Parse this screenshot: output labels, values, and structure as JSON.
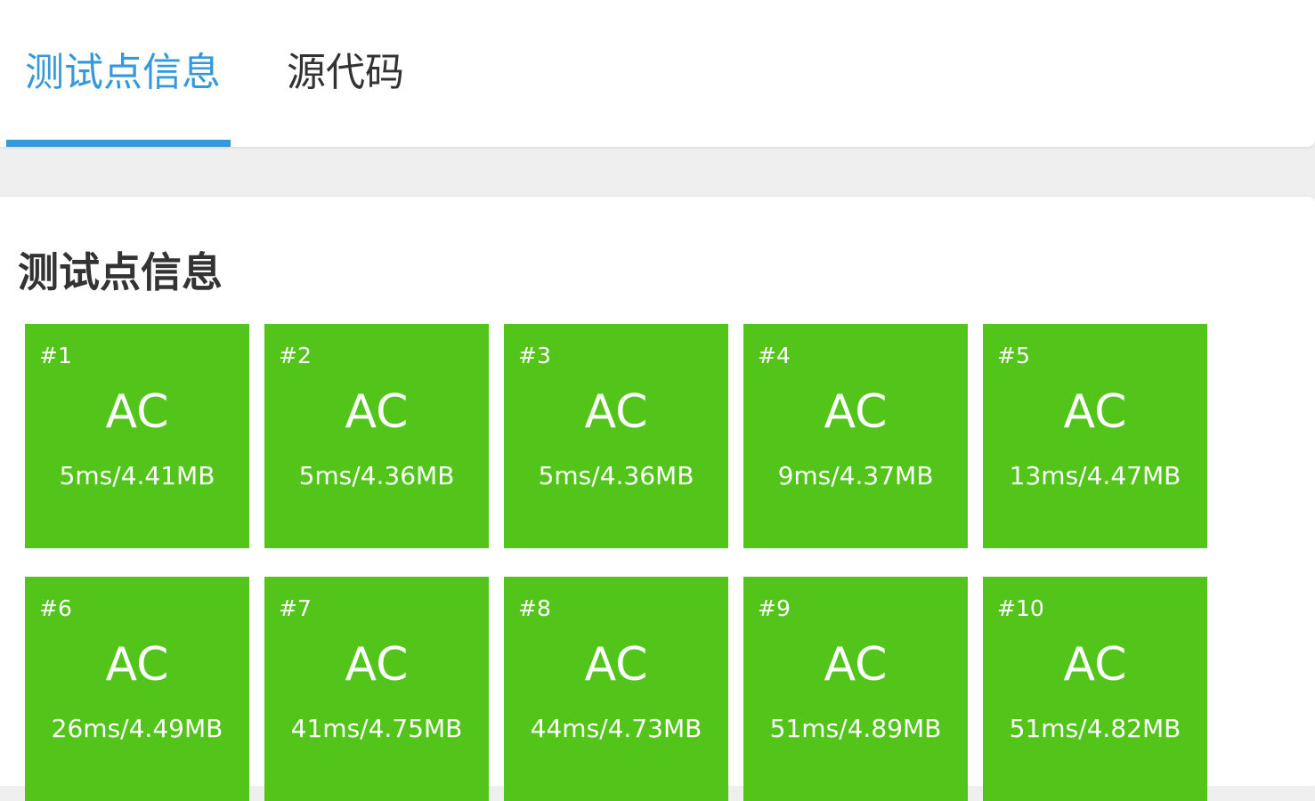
{
  "tabs": [
    {
      "label": "测试点信息",
      "active": true
    },
    {
      "label": "源代码",
      "active": false
    }
  ],
  "colors": {
    "accent": "#3498db",
    "ac": "#52c41a"
  },
  "section": {
    "title": "测试点信息"
  },
  "test_cases": [
    {
      "id": "#1",
      "status": "AC",
      "stats": "5ms/4.41MB"
    },
    {
      "id": "#2",
      "status": "AC",
      "stats": "5ms/4.36MB"
    },
    {
      "id": "#3",
      "status": "AC",
      "stats": "5ms/4.36MB"
    },
    {
      "id": "#4",
      "status": "AC",
      "stats": "9ms/4.37MB"
    },
    {
      "id": "#5",
      "status": "AC",
      "stats": "13ms/4.47MB"
    },
    {
      "id": "#6",
      "status": "AC",
      "stats": "26ms/4.49MB"
    },
    {
      "id": "#7",
      "status": "AC",
      "stats": "41ms/4.75MB"
    },
    {
      "id": "#8",
      "status": "AC",
      "stats": "44ms/4.73MB"
    },
    {
      "id": "#9",
      "status": "AC",
      "stats": "51ms/4.89MB"
    },
    {
      "id": "#10",
      "status": "AC",
      "stats": "51ms/4.82MB"
    }
  ]
}
